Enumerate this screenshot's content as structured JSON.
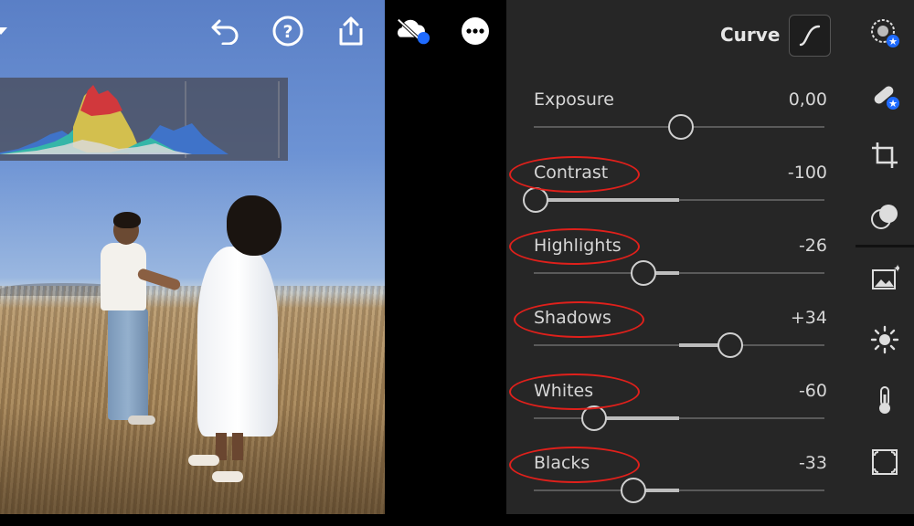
{
  "toolbar": {
    "icons": [
      "dropdown-arrow-icon",
      "undo-icon",
      "help-icon",
      "share-icon",
      "cloud-sync-off-icon",
      "more-options-icon"
    ]
  },
  "panel": {
    "title": "Curve",
    "curve_button_icon": "curve-icon",
    "sliders": [
      {
        "label": "Exposure",
        "value": "0,00",
        "level": 0.5
      },
      {
        "label": "Contrast",
        "value": "-100",
        "level": 0.0
      },
      {
        "label": "Highlights",
        "value": "-26",
        "level": 0.37
      },
      {
        "label": "Shadows",
        "value": "+34",
        "level": 0.67
      },
      {
        "label": "Whites",
        "value": "-60",
        "level": 0.2
      },
      {
        "label": "Blacks",
        "value": "-33",
        "level": 0.335
      }
    ],
    "highlighted_labels": [
      "Contrast",
      "Highlights",
      "Shadows",
      "Whites",
      "Blacks"
    ]
  },
  "tools": {
    "icons": [
      "selective-edit-icon",
      "healing-icon",
      "crop-icon",
      "presets-icon",
      "auto-enhance-icon",
      "light-icon",
      "temperature-icon",
      "effects-vignette-icon"
    ]
  },
  "colors": {
    "panel_bg": "#262626",
    "annotation_red": "#e0201b",
    "badge_blue": "#1f6bff"
  }
}
